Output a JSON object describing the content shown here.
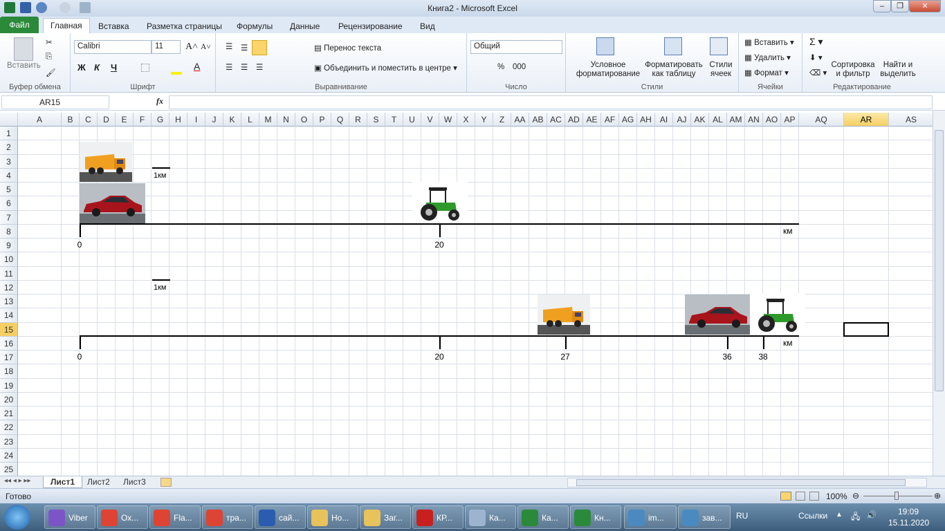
{
  "window": {
    "title": "Книга2 - Microsoft Excel",
    "minimize": "–",
    "restore": "❐",
    "close": "✕"
  },
  "tabs": [
    "Файл",
    "Главная",
    "Вставка",
    "Разметка страницы",
    "Формулы",
    "Данные",
    "Рецензирование",
    "Вид"
  ],
  "ribbon": {
    "clipboard": {
      "paste": "Вставить",
      "label": "Буфер обмена"
    },
    "font": {
      "name": "Calibri",
      "size": "11",
      "bold": "Ж",
      "italic": "К",
      "underline": "Ч",
      "label": "Шрифт"
    },
    "alignment": {
      "wrap": "Перенос текста",
      "merge": "Объединить и поместить в центре",
      "label": "Выравнивание"
    },
    "number": {
      "format": "Общий",
      "percent": "%",
      "thousands": "000",
      "label": "Число"
    },
    "styles": {
      "conditional": "Условное форматирование",
      "table": "Форматировать как таблицу",
      "cell": "Стили ячеек",
      "label": "Стили"
    },
    "cells": {
      "insert": "Вставить",
      "delete": "Удалить",
      "format": "Формат",
      "label": "Ячейки"
    },
    "editing": {
      "sort": "Сортировка и фильтр",
      "find": "Найти и выделить",
      "label": "Редактирование"
    }
  },
  "formula_bar": {
    "name_box": "AR15",
    "fx": "fx",
    "value": ""
  },
  "columns": [
    "A",
    "B",
    "C",
    "D",
    "E",
    "F",
    "G",
    "H",
    "I",
    "J",
    "K",
    "L",
    "M",
    "N",
    "O",
    "P",
    "Q",
    "R",
    "S",
    "T",
    "U",
    "V",
    "W",
    "X",
    "Y",
    "Z",
    "AA",
    "AB",
    "AC",
    "AD",
    "AE",
    "AF",
    "AG",
    "AH",
    "AI",
    "AJ",
    "AK",
    "AL",
    "AM",
    "AN",
    "AO",
    "AP",
    "AQ",
    "AR",
    "AS"
  ],
  "rows": [
    1,
    2,
    3,
    4,
    5,
    6,
    7,
    8,
    9,
    10,
    11,
    12,
    13,
    14,
    15,
    16,
    17,
    18,
    19,
    20,
    21,
    22,
    23,
    24,
    25
  ],
  "selected": {
    "column": "AR",
    "row": 15
  },
  "diagram1": {
    "scale": "1км",
    "unit": "км",
    "ticks": [
      0,
      20
    ],
    "vehicles": {
      "truck": 0,
      "car": 0,
      "tractor": 20
    }
  },
  "diagram2": {
    "scale": "1км",
    "unit": "км",
    "ticks": [
      0,
      20,
      27,
      36,
      38
    ],
    "vehicles": {
      "truck": 27,
      "car": 36,
      "tractor": 38
    }
  },
  "sheet_tabs": [
    "Лист1",
    "Лист2",
    "Лист3"
  ],
  "status": {
    "ready": "Готово",
    "zoom": "100%"
  },
  "taskbar": {
    "items": [
      "Viber",
      "Ох...",
      "Fla...",
      "тра...",
      "сай...",
      "Но...",
      "Заг...",
      "КР...",
      "Ка...",
      "Ка...",
      "Кн...",
      "im...",
      "зав..."
    ],
    "lang": "RU",
    "links": "Ссылки",
    "time": "19:09",
    "date": "15.11.2020"
  },
  "colors": {
    "accent": "#2a8a3a",
    "selection": "#f6cf63"
  }
}
